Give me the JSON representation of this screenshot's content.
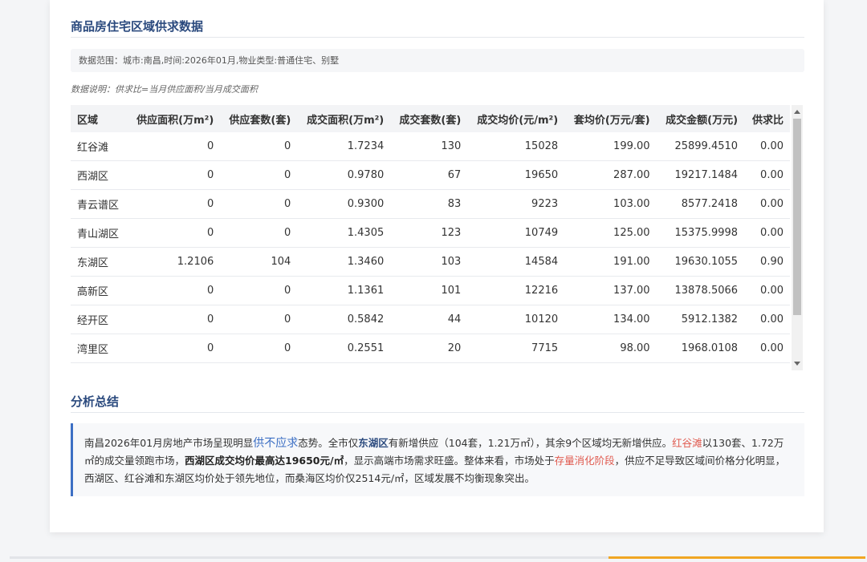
{
  "header": {
    "title": "商品房住宅区域供求数据",
    "range": "数据范围：城市:南昌,时间:2026年01月,物业类型:普通住宅、别墅",
    "note": "数据说明：供求比=当月供应面积/当月成交面积"
  },
  "table": {
    "columns": [
      "区域",
      "供应面积(万m²)",
      "供应套数(套)",
      "成交面积(万m²)",
      "成交套数(套)",
      "成交均价(元/m²)",
      "套均价(万元/套)",
      "成交金额(万元)",
      "供求比"
    ],
    "rows": [
      [
        "红谷滩",
        "0",
        "0",
        "1.7234",
        "130",
        "15028",
        "199.00",
        "25899.4510",
        "0.00"
      ],
      [
        "西湖区",
        "0",
        "0",
        "0.9780",
        "67",
        "19650",
        "287.00",
        "19217.1484",
        "0.00"
      ],
      [
        "青云谱区",
        "0",
        "0",
        "0.9300",
        "83",
        "9223",
        "103.00",
        "8577.2418",
        "0.00"
      ],
      [
        "青山湖区",
        "0",
        "0",
        "1.4305",
        "123",
        "10749",
        "125.00",
        "15375.9998",
        "0.00"
      ],
      [
        "东湖区",
        "1.2106",
        "104",
        "1.3460",
        "103",
        "14584",
        "191.00",
        "19630.1055",
        "0.90"
      ],
      [
        "高新区",
        "0",
        "0",
        "1.1361",
        "101",
        "12216",
        "137.00",
        "13878.5066",
        "0.00"
      ],
      [
        "经开区",
        "0",
        "0",
        "0.5842",
        "44",
        "10120",
        "134.00",
        "5912.1382",
        "0.00"
      ],
      [
        "湾里区",
        "0",
        "0",
        "0.2551",
        "20",
        "7715",
        "98.00",
        "1968.0108",
        "0.00"
      ]
    ]
  },
  "analysis": {
    "title": "分析总结",
    "p1": "南昌2026年01月房地产市场呈现明显",
    "hl1": "供不应求",
    "p2": "态势。全市仅",
    "hl2": "东湖区",
    "p3": "有新增供应（104套，1.21万㎡），其余9个区域均无新增供应。",
    "hl3": "红谷滩",
    "p4": "以130套、1.72万㎡的成交量领跑市场，",
    "hl4": "西湖区成交均价最高达19650元/㎡",
    "p5": "，显示高端市场需求旺盛。整体来看，市场处于",
    "hl5": "存量消化阶段",
    "p6": "，供应不足导致区域间价格分化明显，西湖区、红谷滩和东湖区均价处于领先地位，而桑海区均价仅2514元/㎡，区域发展不均衡现象突出。"
  },
  "colors": {
    "title": "#2b4a7e",
    "accent_blue": "#3c6fc4",
    "accent_red": "#e05a4f",
    "bottom_accent": "#f0a623"
  }
}
